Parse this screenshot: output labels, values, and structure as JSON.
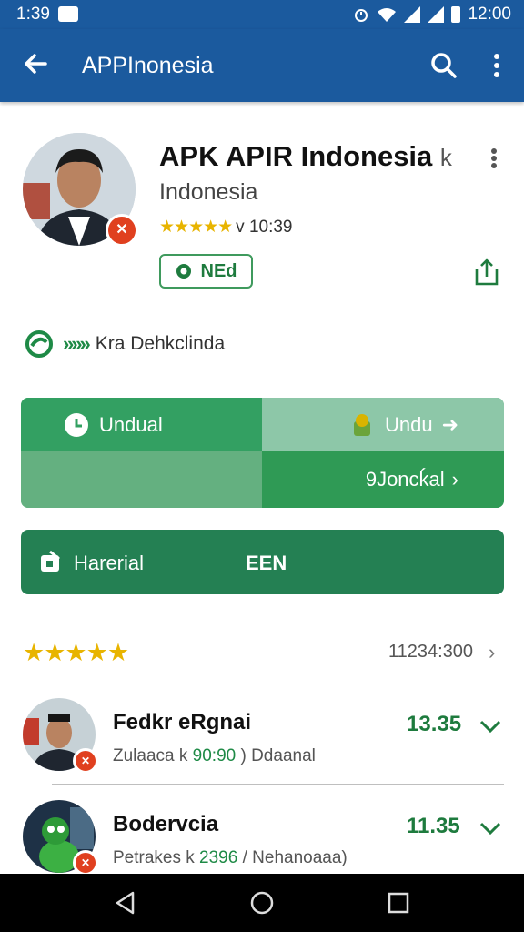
{
  "status_bar": {
    "time": "1:39",
    "clock": "12:00"
  },
  "app_bar": {
    "title": "APPInonesia"
  },
  "app": {
    "title": "APK APIR Indonesia",
    "title_suffix": "k",
    "subtitle": "Indonesia",
    "stars": "★★★★★",
    "rating_meta": "v 10:39",
    "tag": "NEd",
    "developer": "Kra Dehkclinda"
  },
  "download": {
    "btn_a": "Undual",
    "btn_b": "Undu",
    "btn_d": "9Joncḱal"
  },
  "primary": {
    "label": "Harerial",
    "code": "EEN"
  },
  "reviews": {
    "stars": "★★★★★",
    "count": "11234:300"
  },
  "items": [
    {
      "name": "Fedkr eRgnai",
      "meta_a": "Zulaaca k",
      "meta_g": "90:90",
      "meta_b": ") Ddaanal",
      "value": "13.35"
    },
    {
      "name": "Bodervcia",
      "meta_a": "Petrakes k",
      "meta_g": "2396",
      "meta_b": "/ Nehanoaaa)",
      "value": "11.35"
    }
  ],
  "colors": {
    "primary_blue": "#1b5a9e",
    "accent_green": "#248053",
    "star": "#e8b400"
  }
}
